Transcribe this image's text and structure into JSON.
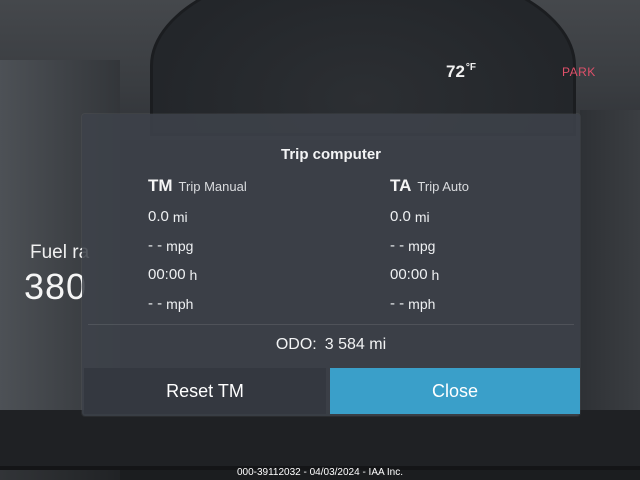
{
  "header": {
    "temperature": "72",
    "temperature_unit": "°F",
    "gear": "PARK"
  },
  "side": {
    "label": "Fuel ra",
    "value": "380"
  },
  "dialog": {
    "title": "Trip computer",
    "trip_manual": {
      "abbr": "TM",
      "name": "Trip Manual",
      "distance": "0.0",
      "distance_unit": "mi",
      "economy": "- -",
      "economy_unit": "mpg",
      "time": "00:00",
      "time_unit": "h",
      "speed": "- -",
      "speed_unit": "mph"
    },
    "trip_auto": {
      "abbr": "TA",
      "name": "Trip Auto",
      "distance": "0.0",
      "distance_unit": "mi",
      "economy": "- -",
      "economy_unit": "mpg",
      "time": "00:00",
      "time_unit": "h",
      "speed": "- -",
      "speed_unit": "mph"
    },
    "odometer": {
      "label": "ODO:",
      "value": "3 584",
      "unit": "mi"
    },
    "buttons": {
      "reset_label": "Reset TM",
      "close_label": "Close"
    }
  },
  "watermark": "000-39112032 - 04/03/2024 - IAA Inc.",
  "colors": {
    "close_button": "#3a9fc9",
    "park_text": "#e0506a",
    "dialog_bg": "#3e424a"
  }
}
